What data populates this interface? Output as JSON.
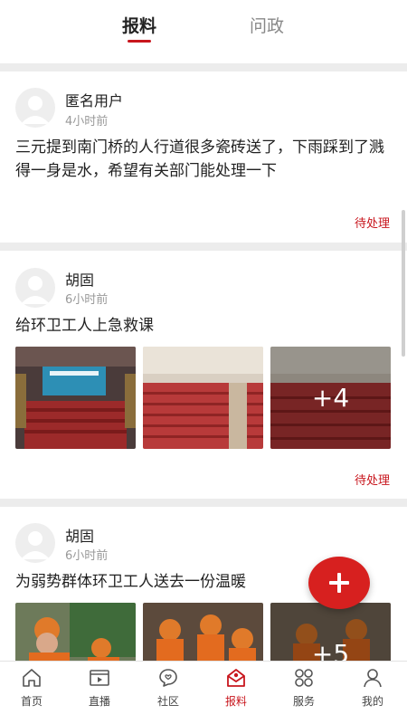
{
  "top_tabs": [
    {
      "label": "报料",
      "active": true
    },
    {
      "label": "问政",
      "active": false
    }
  ],
  "accent_color": "#c8161d",
  "posts": [
    {
      "user": "匿名用户",
      "time": "4小时前",
      "text": "三元提到南门桥的人行道很多瓷砖送了，下雨踩到了溅得一身是水，希望有关部门能处理一下",
      "status": "待处理"
    },
    {
      "user": "胡固",
      "time": "6小时前",
      "text": "给环卫工人上急救课",
      "more_count": "+4",
      "status": "待处理"
    },
    {
      "user": "胡固",
      "time": "6小时前",
      "text": "为弱势群体环卫工人送去一份温暖",
      "more_count": "+5"
    }
  ],
  "fab_icon": "plus-icon",
  "bottom_nav": [
    {
      "label": "首页",
      "icon": "home-icon",
      "active": false
    },
    {
      "label": "直播",
      "icon": "live-video-icon",
      "active": false
    },
    {
      "label": "社区",
      "icon": "community-chat-icon",
      "active": false
    },
    {
      "label": "报料",
      "icon": "report-envelope-icon",
      "active": true
    },
    {
      "label": "服务",
      "icon": "services-grid-icon",
      "active": false
    },
    {
      "label": "我的",
      "icon": "profile-icon",
      "active": false
    }
  ]
}
